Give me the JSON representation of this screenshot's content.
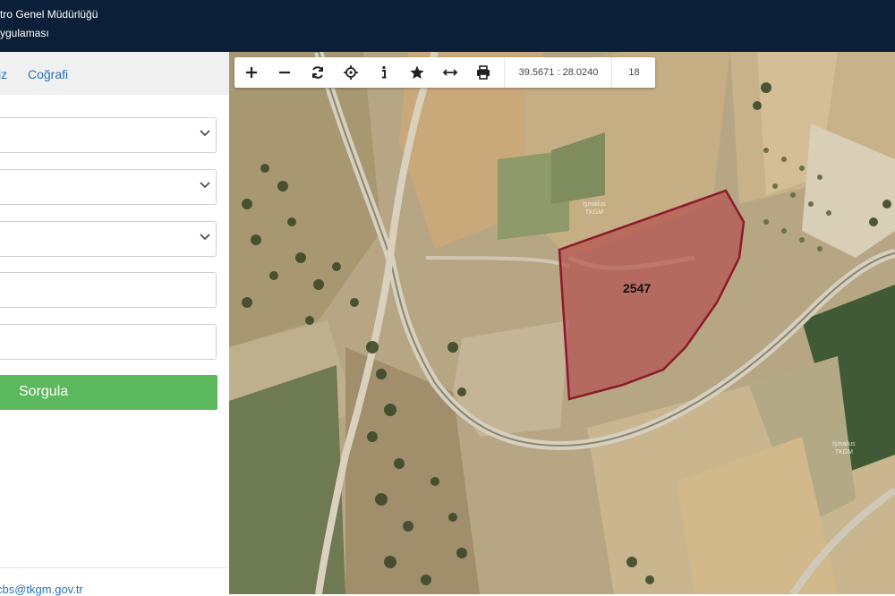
{
  "header": {
    "title_line1": "tro Genel Müdürlüğü",
    "title_line2": "ygulaması"
  },
  "sidebar": {
    "tabs": [
      {
        "label": "iz"
      },
      {
        "label": "Coğrafi"
      }
    ],
    "query_button_label": "Sorgula",
    "footer_email": "cbs@tkgm.gov.tr"
  },
  "map": {
    "coordinates": "39.5671 : 28.0240",
    "zoom_level": "18",
    "parcel_number": "2547",
    "watermark_line1": "Işmailus",
    "watermark_line2": "TKGM",
    "tools": [
      {
        "icon": "zoom-in-icon"
      },
      {
        "icon": "zoom-out-icon"
      },
      {
        "icon": "refresh-icon"
      },
      {
        "icon": "locate-icon"
      },
      {
        "icon": "info-icon"
      },
      {
        "icon": "star-icon"
      },
      {
        "icon": "measure-icon"
      },
      {
        "icon": "print-icon"
      }
    ],
    "colors": {
      "parcel_stroke": "#8b1a2b",
      "parcel_fill": "#b34a4a"
    }
  }
}
